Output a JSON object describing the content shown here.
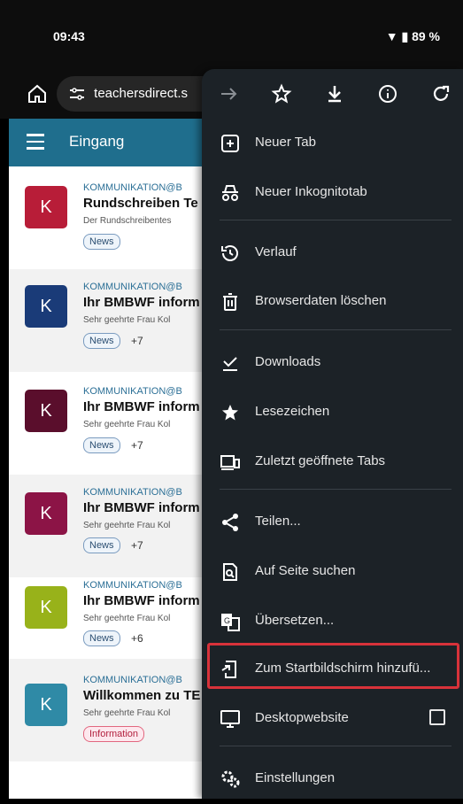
{
  "status": {
    "time": "09:43",
    "battery": "89 %"
  },
  "browser": {
    "url": "teachersdirect.s"
  },
  "app": {
    "title": "Eingang"
  },
  "mails": [
    {
      "avatar": "K",
      "color": "#b81d38",
      "sender": "KOMMUNIKATION@B",
      "subject": "Rundschreiben Te",
      "preview": "Der Rundschreibentes",
      "tag": "News",
      "extra": ""
    },
    {
      "avatar": "K",
      "color": "#1a3b78",
      "sender": "KOMMUNIKATION@B",
      "subject": "Ihr BMBWF inform",
      "preview": "Sehr geehrte Frau Kol",
      "tag": "News",
      "extra": "+7"
    },
    {
      "avatar": "K",
      "color": "#5a0e2c",
      "sender": "KOMMUNIKATION@B",
      "subject": "Ihr BMBWF inform",
      "preview": "Sehr geehrte Frau Kol",
      "tag": "News",
      "extra": "+7"
    },
    {
      "avatar": "K",
      "color": "#8c1446",
      "sender": "KOMMUNIKATION@B",
      "subject": "Ihr BMBWF inform",
      "preview": "Sehr geehrte Frau Kol",
      "tag": "News",
      "extra": "+7"
    },
    {
      "avatar": "K",
      "color": "#98b21a",
      "sender": "KOMMUNIKATION@B",
      "subject": "Ihr BMBWF inform",
      "preview": "Sehr geehrte Frau Kol",
      "tag": "News",
      "extra": "+6"
    },
    {
      "avatar": "K",
      "color": "#2f8aa6",
      "sender": "KOMMUNIKATION@B",
      "subject": "Willkommen zu TE",
      "preview": "Sehr geehrte Frau Kol",
      "tag": "Information",
      "extra": ""
    }
  ],
  "menu": {
    "toolbar": [
      "forward-icon",
      "star-icon",
      "download-icon",
      "info-icon",
      "refresh-icon"
    ],
    "items": {
      "new_tab": "Neuer Tab",
      "incognito": "Neuer Inkognitotab",
      "history": "Verlauf",
      "clear_data": "Browserdaten löschen",
      "downloads": "Downloads",
      "bookmarks": "Lesezeichen",
      "recent_tabs": "Zuletzt geöffnete Tabs",
      "share": "Teilen...",
      "find": "Auf Seite suchen",
      "translate": "Übersetzen...",
      "add_home": "Zum Startbildschirm hinzufü...",
      "desktop": "Desktopwebsite",
      "settings": "Einstellungen"
    }
  },
  "colors": {
    "menu_bg": "#1c2227",
    "header": "#1f6e8d",
    "highlight": "#d8323a"
  }
}
